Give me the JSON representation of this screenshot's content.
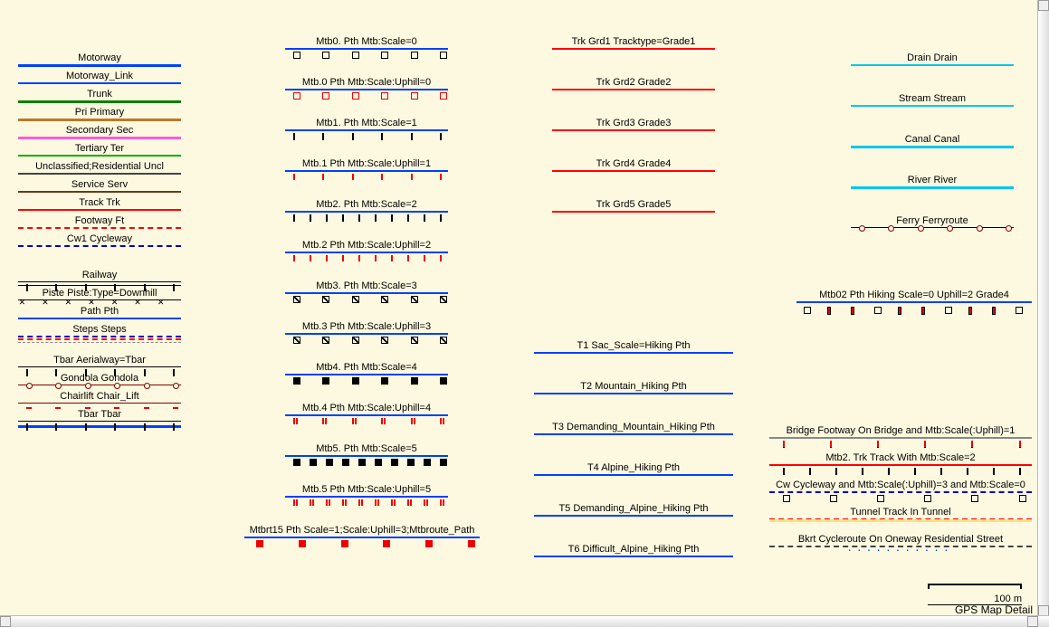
{
  "scale_label": "100 m",
  "map_label": "GPS Map Detail",
  "col1": [
    {
      "t": "Motorway",
      "s": "solid",
      "c": "#0040ff",
      "w": 3
    },
    {
      "t": "Motorway_Link",
      "s": "solid",
      "c": "#0040ff",
      "w": 2
    },
    {
      "t": "Trunk",
      "s": "solid",
      "c": "#008000",
      "w": 3
    },
    {
      "t": "Pri Primary",
      "s": "solid",
      "c": "#b97a2a",
      "w": 3
    },
    {
      "t": "Secondary Sec",
      "s": "solid",
      "c": "#ff5bd8",
      "w": 3
    },
    {
      "t": "Tertiary Ter",
      "s": "solid",
      "c": "#00b000",
      "w": 2
    },
    {
      "t": "Unclassified;Residential Uncl",
      "s": "solid",
      "c": "#444",
      "w": 2
    },
    {
      "t": "Service Serv",
      "s": "solid",
      "c": "#6b3a1a",
      "w": 2
    },
    {
      "t": "Track Trk",
      "s": "solid",
      "c": "#ff0000",
      "w": 2
    },
    {
      "t": "Footway Ft",
      "s": "dashed",
      "c": "#ff0000",
      "w": 2
    },
    {
      "t": "Cw1 Cycleway",
      "s": "dashed",
      "c": "#0000c0",
      "w": 2,
      "gap": 40
    },
    {
      "t": "Railway",
      "s": "rail",
      "c": "#000",
      "w": 1
    },
    {
      "t": "Piste Piste:Type=Downhill",
      "s": "x",
      "c": "#000",
      "w": 1,
      "under": "#00d8d0"
    },
    {
      "t": "Path Pth",
      "s": "solid",
      "c": "#0040ff",
      "w": 2
    },
    {
      "t": "Steps Steps",
      "s": "dashed",
      "c": "#0000c0",
      "w": 2,
      "multi": "#ff0000"
    },
    {
      "t": "",
      "s": "dashed",
      "c": "#888",
      "w": 1,
      "nolabel": true
    },
    {
      "t": "Tbar Aerialway=Tbar",
      "s": "solid",
      "c": "#000",
      "w": 1,
      "tk": "black-vert"
    },
    {
      "t": "Gondola Gondola",
      "s": "solid",
      "c": "#800",
      "w": 1,
      "tk": "circles"
    },
    {
      "t": "Chairlift Chair_Lift",
      "s": "solid",
      "c": "#800",
      "w": 1,
      "tk": "red-h"
    },
    {
      "t": "Tbar Tbar",
      "s": "solid",
      "c": "#000",
      "w": 1,
      "tk": "black-vert",
      "under2": "#0040ff"
    }
  ],
  "col2": [
    {
      "t": "Mtb0. Pth Mtb:Scale=0",
      "c": "#0040ff",
      "tk": "open-black-sq"
    },
    {
      "t": "Mtb.0 Pth Mtb:Scale:Uphill=0",
      "c": "#0040ff",
      "tk": "open-red-sq"
    },
    {
      "t": "Mtb1. Pth Mtb:Scale=1",
      "c": "#0040ff",
      "tk": "black-vert"
    },
    {
      "t": "Mtb.1 Pth Mtb:Scale:Uphill=1",
      "c": "#0040ff",
      "tk": "red-vert"
    },
    {
      "t": "Mtb2. Pth Mtb:Scale=2",
      "c": "#0040ff",
      "tk": "black-vert",
      "dense": true
    },
    {
      "t": "Mtb.2 Pth Mtb:Scale:Uphill=2",
      "c": "#0040ff",
      "tk": "red-vert",
      "dense": true
    },
    {
      "t": "Mtb3. Pth Mtb:Scale=3",
      "c": "#0040ff",
      "tk": "diag"
    },
    {
      "t": "Mtb.3 Pth Mtb:Scale:Uphill=3",
      "c": "#0040ff",
      "tk": "diag",
      "red": true
    },
    {
      "t": "Mtb4. Pth Mtb:Scale=4",
      "c": "#0040ff",
      "tk": "filled-black-sq"
    },
    {
      "t": "Mtb.4 Pth Mtb:Scale:Uphill=4",
      "c": "#0040ff",
      "tk": "red-double-v"
    },
    {
      "t": "Mtb5. Pth Mtb:Scale=5",
      "c": "#0040ff",
      "tk": "filled-black-sq",
      "dense": true
    },
    {
      "t": "Mtb.5 Pth Mtb:Scale:Uphill=5",
      "c": "#0040ff",
      "tk": "red-double-v",
      "dense": true
    },
    {
      "t": "Mtbrt15 Pth Scale=1;Scale:Uphill=3;Mtbroute_Path",
      "c": "#0040ff",
      "tk": "red-sq-filled",
      "mix": true,
      "wide": true
    }
  ],
  "col3a": [
    {
      "t": "Trk Grd1 Tracktype=Grade1",
      "c": "#ff0000",
      "s": "solid"
    },
    {
      "t": "Trk Grd2 Grade2",
      "c": "#ff0000",
      "s": "solid"
    },
    {
      "t": "Trk Grd3 Grade3",
      "c": "#ff0000",
      "s": "solid"
    },
    {
      "t": "Trk Grd4 Grade4",
      "c": "#ff0000",
      "s": "solid"
    },
    {
      "t": "Trk Grd5 Grade5",
      "c": "#ff0000",
      "s": "solid"
    }
  ],
  "col3b": [
    {
      "t": "T1 Sac_Scale=Hiking Pth",
      "c": "#0040ff",
      "s": "solid"
    },
    {
      "t": "T2 Mountain_Hiking Pth",
      "c": "#0040ff",
      "s": "solid"
    },
    {
      "t": "T3 Demanding_Mountain_Hiking Pth",
      "c": "#0040ff",
      "s": "solid"
    },
    {
      "t": "T4 Alpine_Hiking Pth",
      "c": "#0040ff",
      "s": "solid"
    },
    {
      "t": "T5 Demanding_Alpine_Hiking Pth",
      "c": "#0040ff",
      "s": "solid"
    },
    {
      "t": "T6 Difficult_Alpine_Hiking Pth",
      "c": "#0040ff",
      "s": "solid"
    }
  ],
  "col4a": [
    {
      "t": "Drain Drain",
      "c": "#00c8e8",
      "w": 2
    },
    {
      "t": "Stream Stream",
      "c": "#00c8e8",
      "w": 2
    },
    {
      "t": "Canal Canal",
      "c": "#00c8e8",
      "w": 3
    },
    {
      "t": "River River",
      "c": "#00c8e8",
      "w": 3
    },
    {
      "t": "Ferry Ferryroute",
      "c": "#000",
      "w": 1,
      "tk": "circles",
      "ferr": true
    }
  ],
  "col4b": [
    {
      "t": "Mtb02 Pth Hiking Scale=0 Uphill=2 Grade4",
      "c": "#0040ff",
      "tk": "mix"
    }
  ],
  "col4c": [
    {
      "t": "Bridge Footway On Bridge and Mtb:Scale(:Uphill)=1",
      "c": "#888",
      "tk": "black-vert",
      "over": "red-vert"
    },
    {
      "t": "Mtb2. Trk Track With Mtb:Scale=2",
      "c": "#ff0000",
      "tk": "black-vert",
      "dense": true
    },
    {
      "t": "Cw Cycleway and Mtb:Scale(:Uphill)=3 and Mtb:Scale=0",
      "c": "#0000c0",
      "s": "dashed",
      "tk": "diag",
      "over": "open-black-sq"
    },
    {
      "t": "Tunnel Track In Tunnel",
      "c": "#ff0000",
      "s": "dashed",
      "under": "#ffe080"
    },
    {
      "t": "Bkrt Cycleroute On Oneway Residential Street",
      "c": "#444",
      "s": "dashed",
      "dots": true
    }
  ]
}
